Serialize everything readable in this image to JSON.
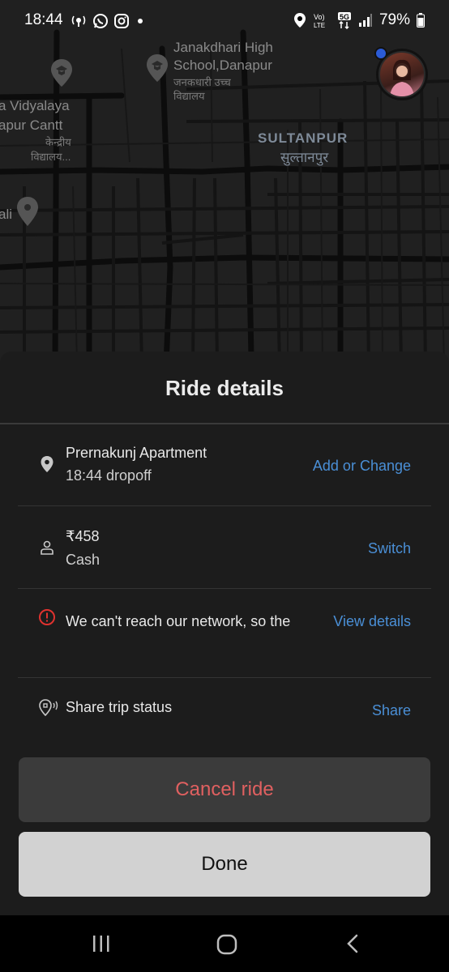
{
  "status_bar": {
    "time": "18:44",
    "battery": "79%"
  },
  "map": {
    "labels": {
      "school_en_1": "Janakdhari High",
      "school_en_2": "School,Danapur",
      "school_hi_1": "जनकधारी उच्च",
      "school_hi_2": "विद्यालय",
      "vidyalaya_1": "a Vidyalaya",
      "vidyalaya_2": "apur Cantt",
      "vidyalaya_hi_1": "केन्द्रीय",
      "vidyalaya_hi_2": "विद्यालय...",
      "area_en": "SULTANPUR",
      "area_hi": "सुल्तानपुर",
      "ali": "ali"
    }
  },
  "sheet": {
    "title": "Ride details",
    "rows": [
      {
        "icon": "location-pin-icon",
        "primary": "Prernakunj Apartment",
        "secondary": "18:44 dropoff",
        "action": "Add or Change"
      },
      {
        "icon": "person-icon",
        "primary": "₹458",
        "secondary": "Cash",
        "action": "Switch"
      },
      {
        "icon": "alert-circle-icon",
        "primary": "We can't reach our network, so the",
        "action": "View details",
        "accent": "#e0322f"
      },
      {
        "icon": "share-location-icon",
        "primary": "Share trip status",
        "action": "Share"
      }
    ],
    "cancel_label": "Cancel ride",
    "done_label": "Done"
  },
  "colors": {
    "link": "#4a8fd6",
    "cancel_text": "#e06060",
    "alert": "#e0322f"
  }
}
